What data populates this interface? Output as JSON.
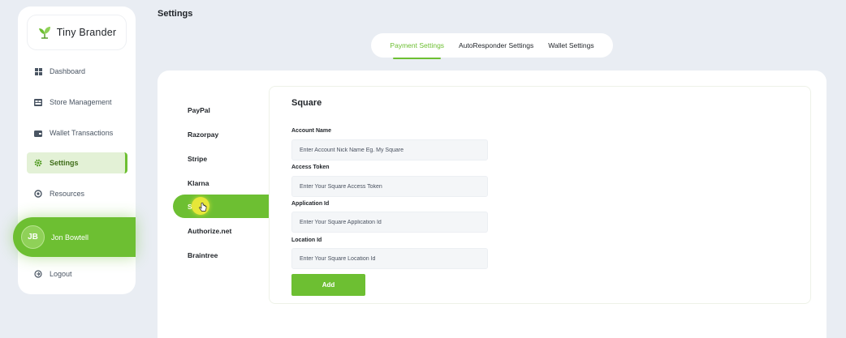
{
  "brand": {
    "name": "Tiny Brander",
    "accent": "#6dbf32"
  },
  "sidebar": {
    "items": [
      {
        "label": "Dashboard",
        "icon": "dashboard-icon"
      },
      {
        "label": "Store Management",
        "icon": "store-icon"
      },
      {
        "label": "Wallet Transactions",
        "icon": "wallet-icon"
      },
      {
        "label": "Settings",
        "icon": "gear-icon",
        "active": true
      },
      {
        "label": "Resources",
        "icon": "resources-icon"
      }
    ],
    "logout_label": "Logout"
  },
  "user": {
    "initials": "JB",
    "name": "Jon Bowtell"
  },
  "header": {
    "title": "Settings"
  },
  "tabs": [
    {
      "label": "Payment Settings",
      "active": true
    },
    {
      "label": "AutoResponder Settings"
    },
    {
      "label": "Wallet Settings"
    }
  ],
  "providers": {
    "items": [
      "PayPal",
      "Razorpay",
      "Stripe",
      "Klarna",
      "Square",
      "Authorize.net",
      "Braintree"
    ],
    "active_label": "S"
  },
  "form": {
    "title": "Square",
    "fields": [
      {
        "label": "Account Name",
        "placeholder": "Enter Account Nick Name Eg. My Square"
      },
      {
        "label": "Access Token",
        "placeholder": "Enter Your Square Access Token"
      },
      {
        "label": "Application Id",
        "placeholder": "Enter Your Square Application Id"
      },
      {
        "label": "Location Id",
        "placeholder": "Enter Your Square Location Id"
      }
    ],
    "submit_label": "Add"
  }
}
